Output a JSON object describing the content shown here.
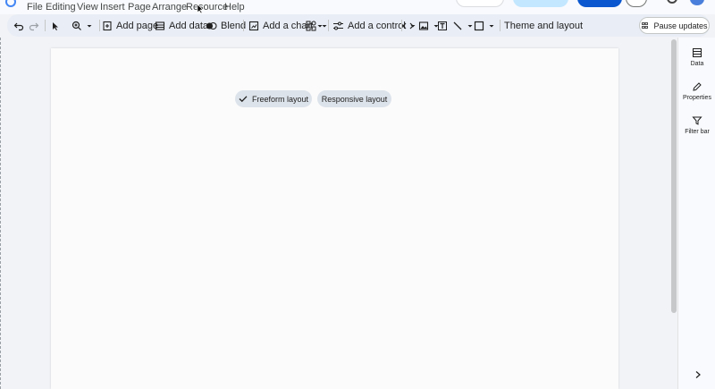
{
  "menu": {
    "items": [
      "File",
      "Editing",
      "View",
      "Insert",
      "Page",
      "Arrange",
      "Resource",
      "Help"
    ]
  },
  "toolbar": {
    "add_page": "Add page",
    "add_data": "Add data",
    "blend": "Blend",
    "add_chart": "Add a chart",
    "add_control": "Add a control",
    "theme_layout": "Theme and layout",
    "pause_updates": "Pause updates"
  },
  "canvas": {
    "freeform_label": "Freeform layout",
    "responsive_label": "Responsive layout"
  },
  "right_panel": {
    "data_label": "Data",
    "properties_label": "Properties",
    "filter_label": "Filter bar"
  },
  "colors": {
    "toolbar_bg": "#e9eef6",
    "chip_bg": "#dde3ea",
    "accent": "#0b57d0"
  }
}
